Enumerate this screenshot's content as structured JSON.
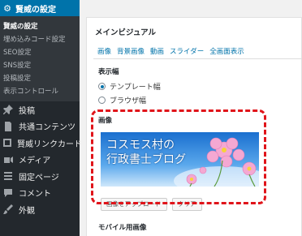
{
  "sidebar": {
    "header": {
      "label": "賢威の設定",
      "icon": "gear-icon"
    },
    "submenu": [
      {
        "label": "賢威の設定",
        "current": true
      },
      {
        "label": "埋め込みコード設定"
      },
      {
        "label": "SEO設定"
      },
      {
        "label": "SNS設定"
      },
      {
        "label": "投稿設定"
      },
      {
        "label": "表示コントロール"
      }
    ],
    "menu": [
      {
        "label": "投稿",
        "icon": "pushpin-icon"
      },
      {
        "label": "共通コンテンツ",
        "icon": "document-icon"
      },
      {
        "label": "賢威リンクカード",
        "icon": "card-icon"
      },
      {
        "label": "メディア",
        "icon": "media-icon"
      },
      {
        "label": "固定ページ",
        "icon": "page-icon"
      },
      {
        "label": "コメント",
        "icon": "comment-icon"
      },
      {
        "label": "外観",
        "icon": "brush-icon"
      }
    ]
  },
  "panel": {
    "title": "メインビジュアル",
    "tabs": [
      "画像",
      "背景画像",
      "動画",
      "スライダー",
      "全画面表示"
    ],
    "width_label": "表示幅",
    "width_options": [
      {
        "label": "テンプレート幅",
        "selected": true
      },
      {
        "label": "ブラウザ幅",
        "selected": false
      }
    ],
    "image_label": "画像",
    "image_text_line1": "コスモス村の",
    "image_text_line2": "行政書士ブログ",
    "upload_button": "画像をアップロード",
    "clear_button": "クリア",
    "mobile_label": "モバイル用画像"
  },
  "colors": {
    "highlight": "#e0141a",
    "accent": "#0073aa",
    "sidebar": "#23282d"
  }
}
